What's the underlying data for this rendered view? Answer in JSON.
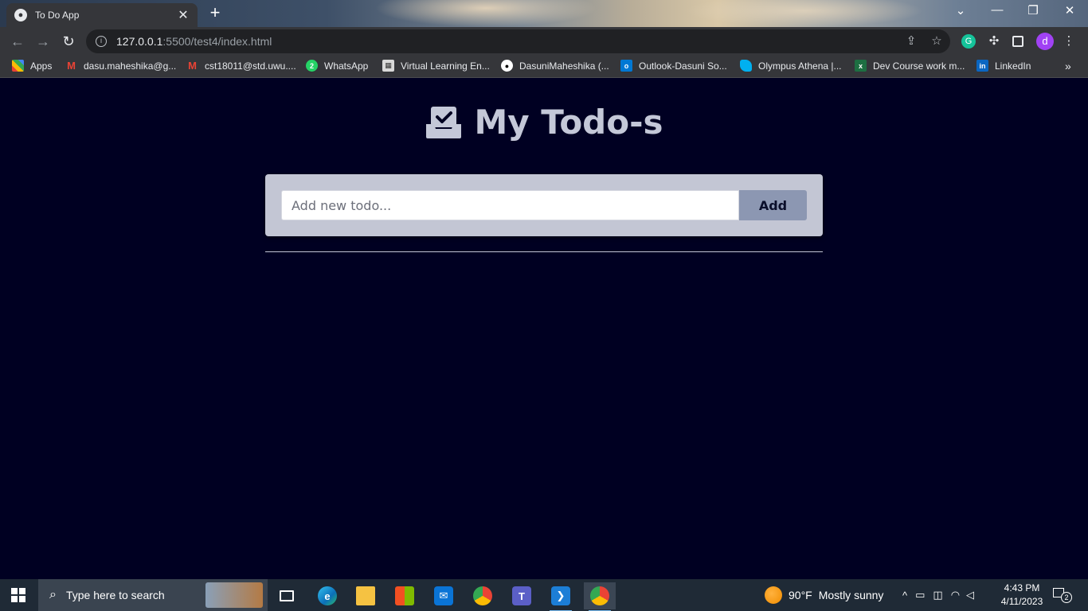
{
  "browser": {
    "tab_title": "To Do App",
    "url_host": "127.0.0.1",
    "url_path": ":5500/test4/index.html",
    "profile_initial": "d"
  },
  "bookmarks": [
    {
      "label": "Apps",
      "icon": "apps-grid-icon",
      "color": "#4285f4"
    },
    {
      "label": "dasu.maheshika@g...",
      "icon": "gmail-icon",
      "color": "#ea4335"
    },
    {
      "label": "cst18011@std.uwu....",
      "icon": "gmail-icon",
      "color": "#ea4335"
    },
    {
      "label": "WhatsApp",
      "icon": "whatsapp-icon",
      "color": "#25d366"
    },
    {
      "label": "Virtual Learning En...",
      "icon": "vle-icon",
      "color": "#d9d9d9"
    },
    {
      "label": "DasuniMaheshika (...",
      "icon": "github-icon",
      "color": "#ffffff"
    },
    {
      "label": "Outlook-Dasuni So...",
      "icon": "outlook-icon",
      "color": "#0078d4"
    },
    {
      "label": "Olympus Athena |...",
      "icon": "olympus-icon",
      "color": "#00b0f0"
    },
    {
      "label": "Dev Course work m...",
      "icon": "excel-icon",
      "color": "#1d6f42"
    },
    {
      "label": "LinkedIn",
      "icon": "linkedin-icon",
      "color": "#0a66c2"
    }
  ],
  "app": {
    "title": "My Todo-s",
    "input_placeholder": "Add new todo...",
    "add_label": "Add"
  },
  "taskbar": {
    "search_placeholder": "Type here to search",
    "weather_temp": "90°F",
    "weather_text": "Mostly sunny",
    "time": "4:43 PM",
    "date": "4/11/2023",
    "notification_count": "2"
  },
  "colors": {
    "page_bg": "#000022",
    "title_color": "#c4c8d8",
    "card_bg": "#c3c6d4",
    "button_bg": "#8c97b2"
  }
}
